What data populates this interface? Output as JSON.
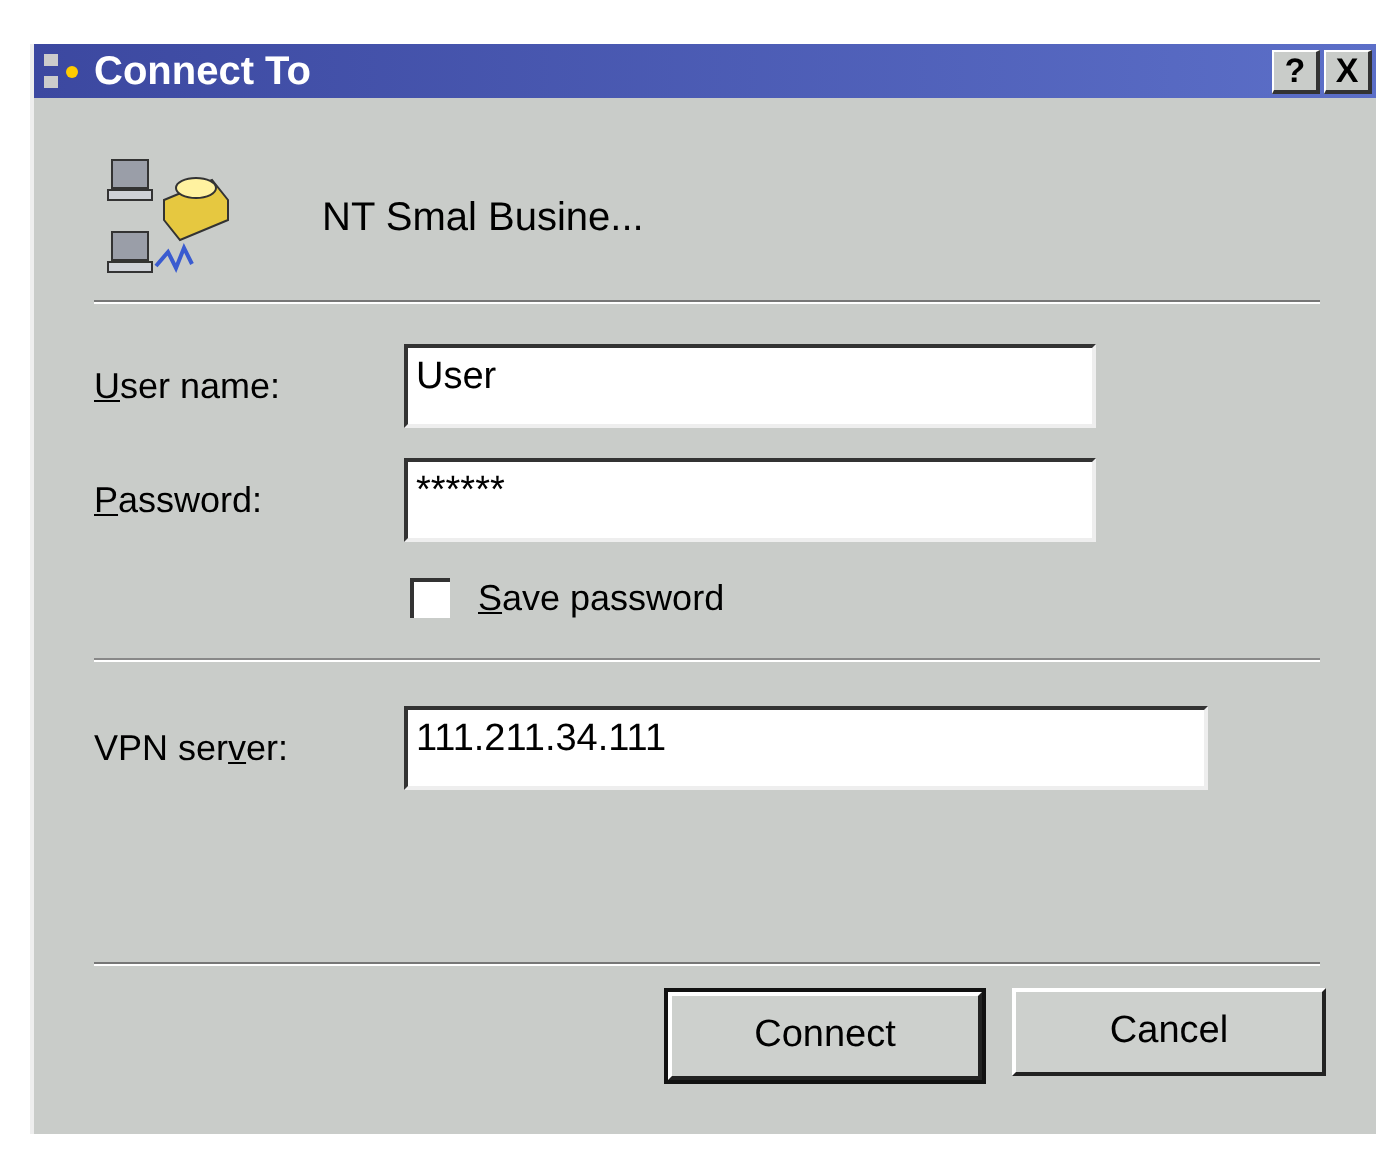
{
  "window": {
    "title": "Connect To",
    "help_button": {
      "label": "?"
    },
    "close_button": {
      "label": "X"
    }
  },
  "connection": {
    "name": "NT Smal Busine..."
  },
  "fields": [
    {
      "label": {
        "key": "U",
        "after": "ser name:"
      },
      "value": "User"
    },
    {
      "label": {
        "key": "P",
        "after": "assword:"
      },
      "value": "******"
    }
  ],
  "save_password": {
    "label": {
      "key": "S",
      "after": "ave password"
    },
    "checked": false
  },
  "vpn_server": {
    "label": {
      "before": "VPN ser",
      "key": "v",
      "after": "er:"
    },
    "value": "111.211.34.111"
  },
  "buttons": [
    {
      "label": "Connect",
      "default": true
    },
    {
      "label": "Cancel",
      "default": false
    }
  ]
}
